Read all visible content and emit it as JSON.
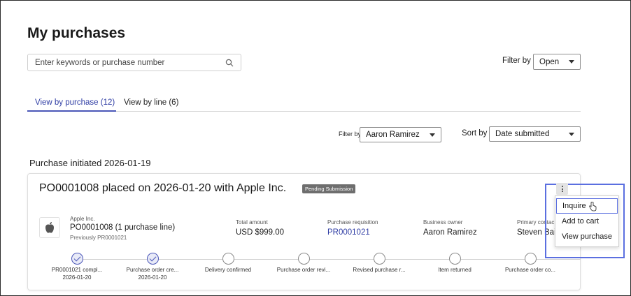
{
  "page": {
    "title": "My purchases"
  },
  "search": {
    "placeholder": "Enter keywords or purchase number"
  },
  "filters": {
    "status_label": "Filter by",
    "status_value": "Open",
    "owner_label": "Filter by",
    "owner_value": "Aaron Ramirez",
    "sort_label": "Sort by",
    "sort_value": "Date submitted"
  },
  "tabs": [
    {
      "label": "View by purchase (12)",
      "active": true
    },
    {
      "label": "View by line (6)",
      "active": false
    }
  ],
  "section": {
    "heading": "Purchase initiated 2026-01-19"
  },
  "card": {
    "title": "PO0001008 placed on 2026-01-20 with Apple Inc.",
    "badge": "Pending Submission",
    "vendor": {
      "name": "Apple Inc.",
      "po": "PO0001008 (1 purchase line)",
      "previous": "Previously PR0001021",
      "logo_icon": "apple-logo-icon"
    },
    "info": [
      {
        "label": "Total amount",
        "value": "USD $999.00",
        "link": false
      },
      {
        "label": "Purchase requisition",
        "value": "PR0001021",
        "link": true
      },
      {
        "label": "Business owner",
        "value": "Aaron Ramirez",
        "link": false
      },
      {
        "label": "Primary contac",
        "value": "Steven Bail",
        "link": false
      }
    ],
    "timeline": [
      {
        "label": "PR0001021 compl...",
        "date": "2026-01-20",
        "done": true
      },
      {
        "label": "Purchase order cre...",
        "date": "2026-01-20",
        "done": true
      },
      {
        "label": "Delivery confirmed",
        "date": "",
        "done": false
      },
      {
        "label": "Purchase order revi...",
        "date": "",
        "done": false
      },
      {
        "label": "Revised purchase r...",
        "date": "",
        "done": false
      },
      {
        "label": "Item returned",
        "date": "",
        "done": false
      },
      {
        "label": "Purchase order co...",
        "date": "",
        "done": false
      }
    ]
  },
  "menu": {
    "items": [
      {
        "label": "Inquire",
        "hover": true
      },
      {
        "label": "Add to cart",
        "hover": false
      },
      {
        "label": "View purchase",
        "hover": false
      }
    ]
  },
  "colors": {
    "accent": "#4a56b8",
    "link": "#2f3da4",
    "badge_bg": "#6e6e6e",
    "highlight": "#5b6fe0"
  }
}
